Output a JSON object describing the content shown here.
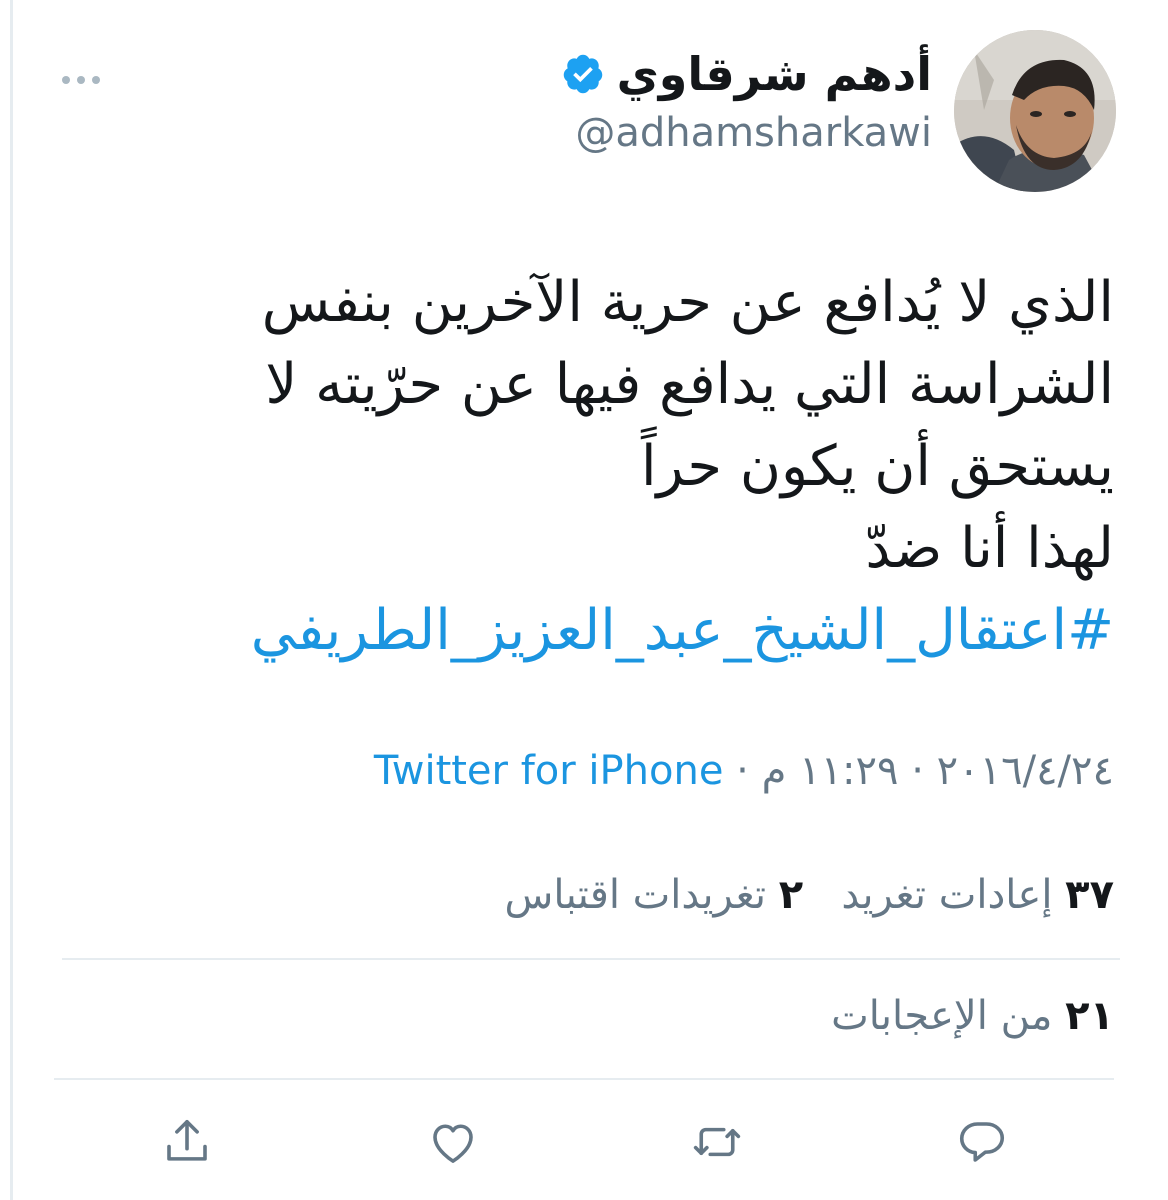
{
  "user": {
    "display_name": "أدهم شرقاوي",
    "handle": "@adhamsharkawi",
    "verified": true,
    "avatar_icon": "profile-photo"
  },
  "tweet": {
    "lines": [
      "الذي لا يُدافع عن حرية الآخرين بنفس",
      "الشراسة التي يدافع فيها عن حرّيته لا",
      "يستحق أن يكون حراً",
      "لهذا أنا ضدّ"
    ],
    "hashtag": "#اعتقال_الشيخ_عبد_العزيز_الطريفي"
  },
  "meta": {
    "date": "٢٠١٦/٤/٢٤",
    "separator": " · ",
    "time": "١١:٢٩ م",
    "source": "Twitter for iPhone"
  },
  "stats": {
    "retweets_count": "٣٧",
    "retweets_label": "إعادات تغريد",
    "quotes_count": "٢",
    "quotes_label": "تغريدات اقتباس",
    "likes_count": "٢١",
    "likes_label": "من الإعجابات"
  },
  "actions": {
    "reply_icon": "reply-icon",
    "retweet_icon": "retweet-icon",
    "like_icon": "heart-icon",
    "share_icon": "share-icon"
  },
  "colors": {
    "link": "#1b95e0",
    "secondary_text": "#657786",
    "primary_text": "#14171a",
    "divider": "#e6ecf0",
    "verified": "#1da1f2"
  }
}
